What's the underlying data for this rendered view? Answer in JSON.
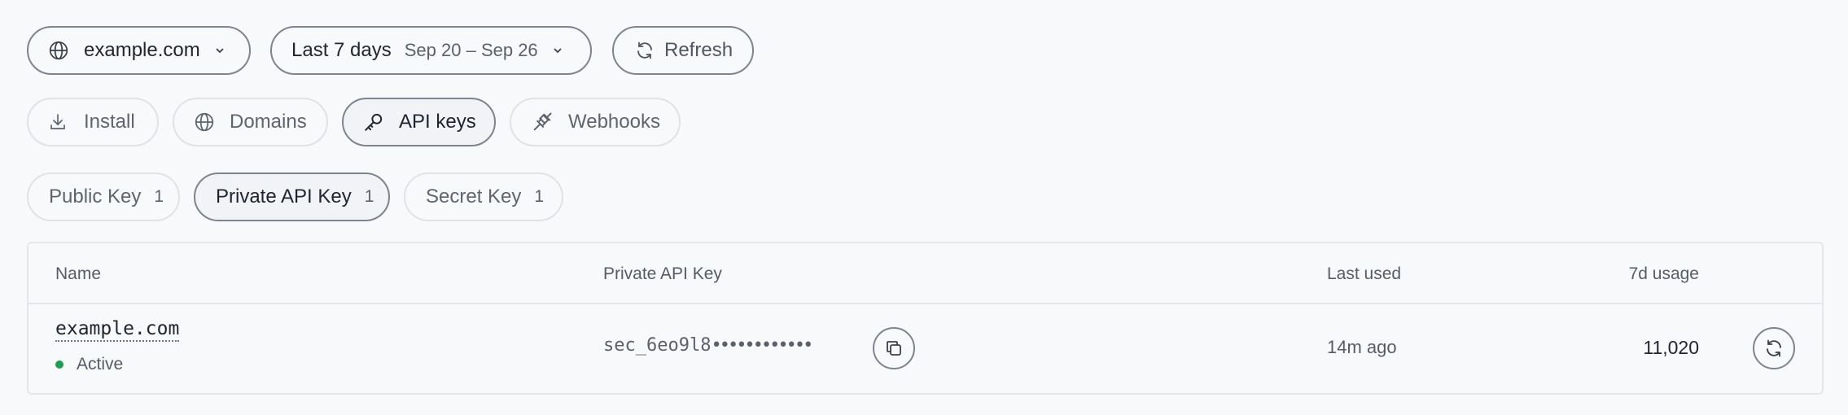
{
  "filters": {
    "domain": {
      "label": "example.com",
      "icon": "globe-icon"
    },
    "range": {
      "label": "Last 7 days",
      "sublabel": "Sep 20 – Sep 26",
      "icon": "chevron-down-icon"
    },
    "refresh": {
      "label": "Refresh",
      "icon": "refresh-icon"
    }
  },
  "tabs": [
    {
      "label": "Install",
      "icon": "download-icon",
      "active": false
    },
    {
      "label": "Domains",
      "icon": "globe-icon",
      "active": false
    },
    {
      "label": "API keys",
      "icon": "key-icon",
      "active": true
    },
    {
      "label": "Webhooks",
      "icon": "plug-icon",
      "active": false
    }
  ],
  "key_types": [
    {
      "label": "Public Key",
      "count": "1",
      "active": false
    },
    {
      "label": "Private API Key",
      "count": "1",
      "active": true
    },
    {
      "label": "Secret Key",
      "count": "1",
      "active": false
    }
  ],
  "table": {
    "headers": {
      "name": "Name",
      "key": "Private API Key",
      "last_used": "Last used",
      "usage": "7d usage"
    },
    "rows": [
      {
        "name": "example.com",
        "status": "Active",
        "status_color": "#1f9d55",
        "key": "sec_6eo9l8",
        "key_mask": "••••••••••••",
        "last_used": "14m ago",
        "usage": "11,020"
      }
    ]
  }
}
